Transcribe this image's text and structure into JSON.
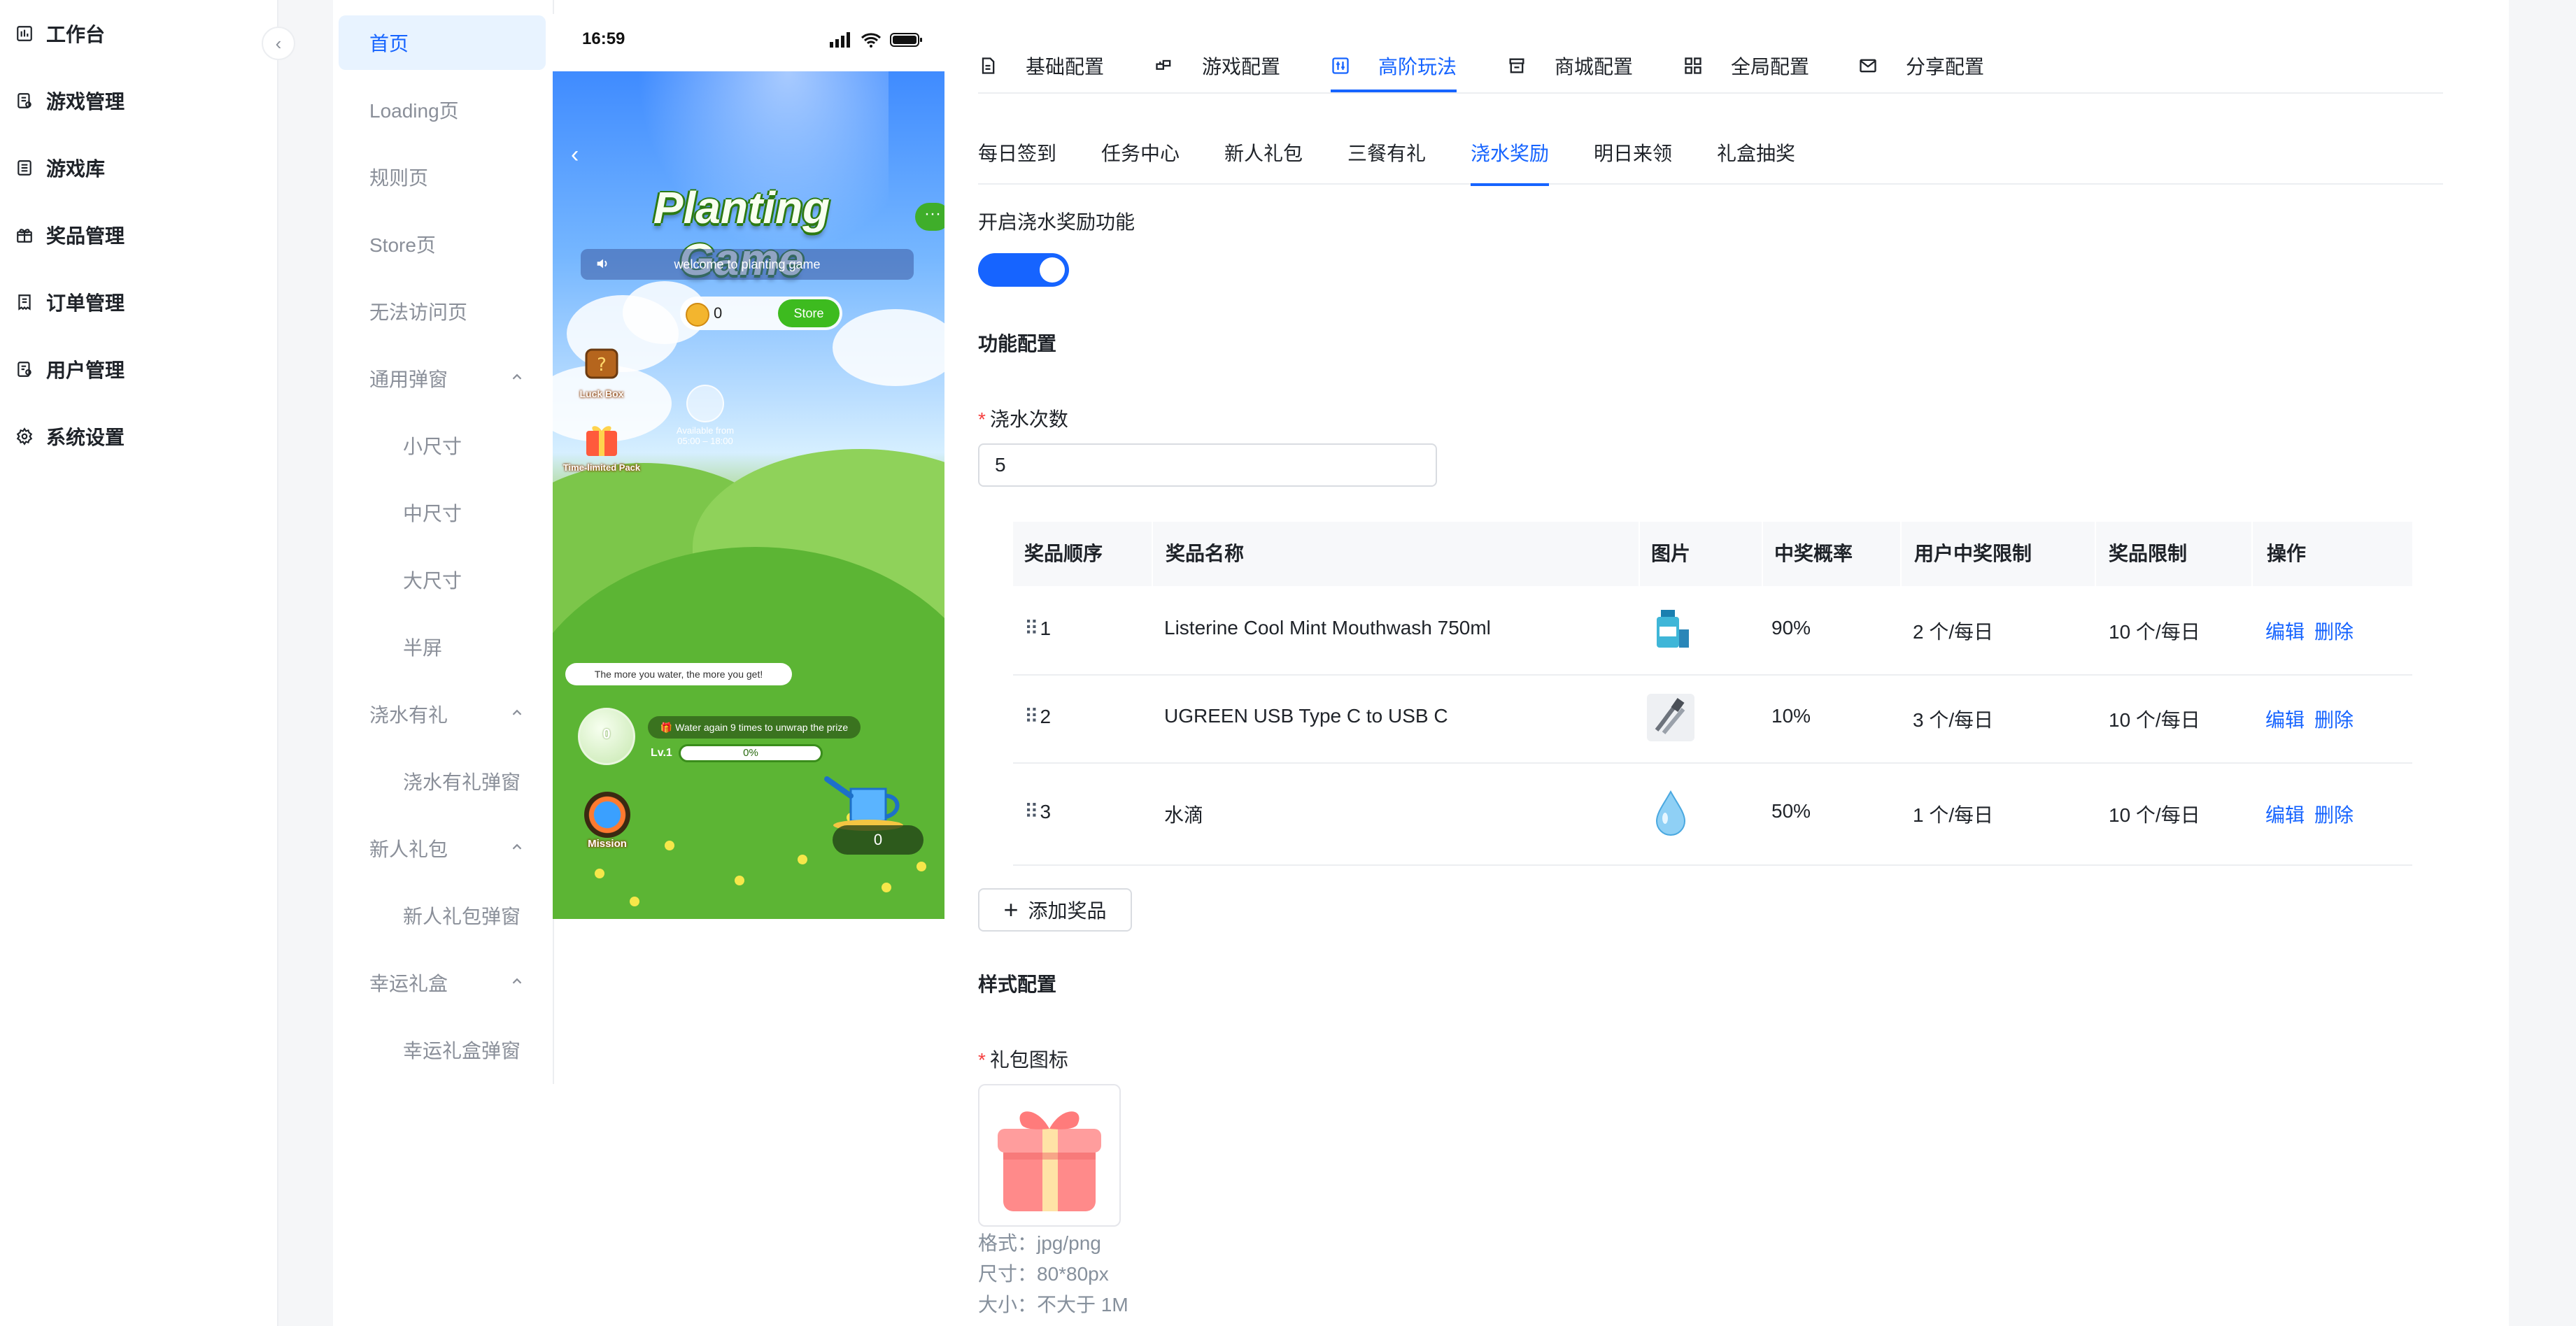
{
  "sidebar": {
    "items": [
      {
        "label": "工作台",
        "icon": "dashboard-icon"
      },
      {
        "label": "游戏管理",
        "icon": "game-manage-icon"
      },
      {
        "label": "游戏库",
        "icon": "library-icon"
      },
      {
        "label": "奖品管理",
        "icon": "gift-icon"
      },
      {
        "label": "订单管理",
        "icon": "order-icon"
      },
      {
        "label": "用户管理",
        "icon": "user-icon"
      },
      {
        "label": "系统设置",
        "icon": "settings-icon"
      }
    ],
    "collapse_glyph": "‹"
  },
  "pages": {
    "items": [
      {
        "label": "首页"
      },
      {
        "label": "Loading页"
      },
      {
        "label": "规则页"
      },
      {
        "label": "Store页"
      },
      {
        "label": "无法访问页"
      },
      {
        "label": "通用弹窗"
      },
      {
        "label": "小尺寸"
      },
      {
        "label": "中尺寸"
      },
      {
        "label": "大尺寸"
      },
      {
        "label": "半屏"
      },
      {
        "label": "浇水有礼"
      },
      {
        "label": "浇水有礼弹窗"
      },
      {
        "label": "新人礼包"
      },
      {
        "label": "新人礼包弹窗"
      },
      {
        "label": "幸运礼盒"
      },
      {
        "label": "幸运礼盒弹窗"
      }
    ]
  },
  "phone": {
    "time": "16:59",
    "game_title": "Planting Game",
    "more": "···",
    "welcome": "welcome to planting game",
    "coins": "0",
    "store": "Store",
    "luck_box": "Luck Box",
    "time_limited_pack": "Time-limited Pack",
    "available_from": "Available from",
    "available_time": "05:00 – 18:00",
    "tip": "The more you water, the more you get!",
    "bottle_value": "0",
    "water_again": "🎁 Water again 9 times to unwrap the prize",
    "level": "Lv.1",
    "progress_text": "0%",
    "progress": 0,
    "mission": "Mission",
    "water_count": "0"
  },
  "tabs_primary": [
    {
      "label": "基础配置",
      "icon": "document-icon"
    },
    {
      "label": "游戏配置",
      "icon": "gamepad-icon"
    },
    {
      "label": "高阶玩法",
      "icon": "advanced-icon"
    },
    {
      "label": "商城配置",
      "icon": "shop-icon"
    },
    {
      "label": "全局配置",
      "icon": "grid-icon"
    },
    {
      "label": "分享配置",
      "icon": "mail-icon"
    }
  ],
  "tabs_secondary": [
    "每日签到",
    "任务中心",
    "新人礼包",
    "三餐有礼",
    "浇水奖励",
    "明日来领",
    "礼盒抽奖"
  ],
  "config": {
    "enable_label": "开启浇水奖励功能",
    "enabled": true,
    "function_section": "功能配置",
    "water_times_label": "浇水次数",
    "water_times_value": "5",
    "table": {
      "headers": [
        "奖品顺序",
        "奖品名称",
        "图片",
        "中奖概率",
        "用户中奖限制",
        "奖品限制",
        "操作"
      ],
      "rows": [
        {
          "order": "1",
          "name": "Listerine Cool Mint Mouthwash 750ml",
          "image": "mouthwash-image",
          "probability": "90%",
          "user_limit": "2 个/每日",
          "prize_limit": "10 个/每日",
          "edit": "编辑",
          "delete": "删除"
        },
        {
          "order": "2",
          "name": "UGREEN USB Type C to USB C",
          "image": "usb-cable-image",
          "probability": "10%",
          "user_limit": "3 个/每日",
          "prize_limit": "10 个/每日",
          "edit": "编辑",
          "delete": "删除"
        },
        {
          "order": "3",
          "name": "水滴",
          "image": "water-drop-image",
          "probability": "50%",
          "user_limit": "1 个/每日",
          "prize_limit": "10 个/每日",
          "edit": "编辑",
          "delete": "删除"
        }
      ],
      "drag_glyph": "⠿"
    },
    "add_prize": "添加奖品",
    "style_section": "样式配置",
    "gift_icon_label": "礼包图标",
    "format_hint": "格式：jpg/png",
    "size_hint": "尺寸：80*80px",
    "filesize_hint": "大小：不大于 1M"
  },
  "colors": {
    "accent": "#1664ff",
    "required": "#f53f3f",
    "muted": "#8a8f99"
  }
}
